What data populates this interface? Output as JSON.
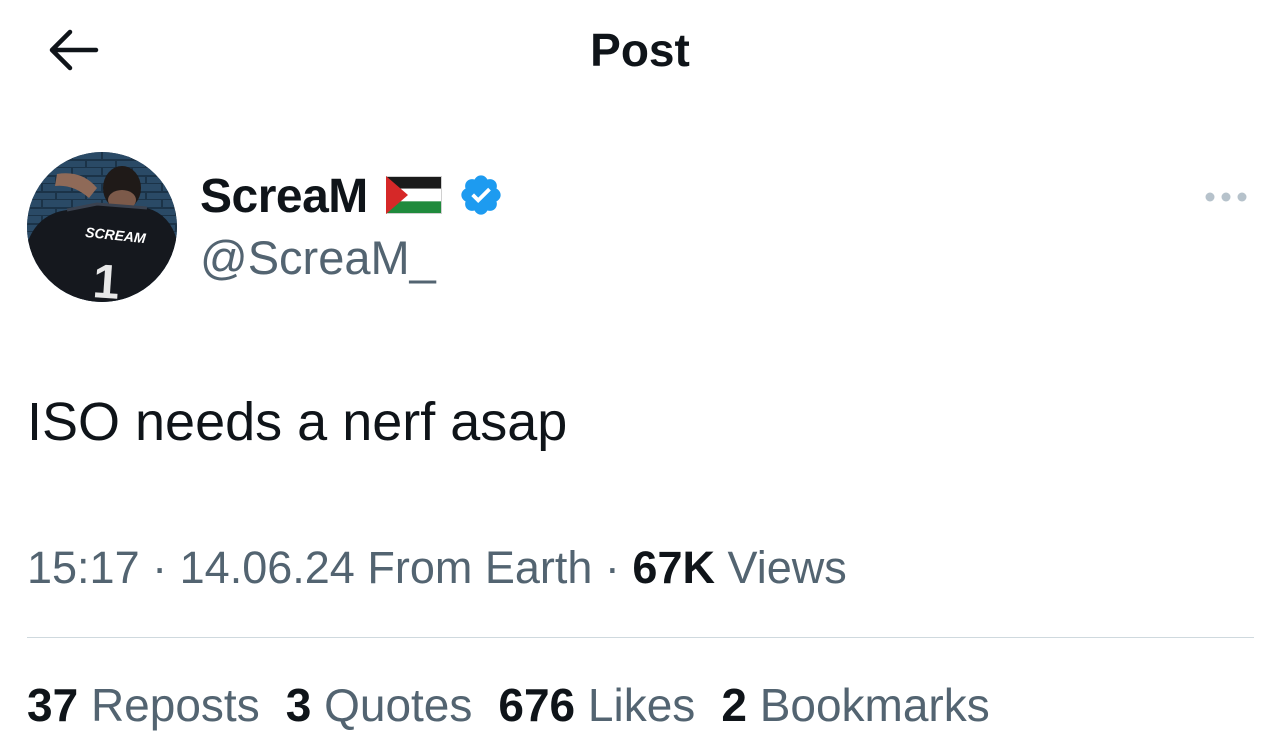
{
  "header": {
    "title": "Post",
    "back_icon": "arrow-left-icon"
  },
  "author": {
    "display_name": "ScreaM",
    "flag_icon": "palestine-flag-icon",
    "verified_icon": "verified-badge-icon",
    "verified_color": "#1d9bf0",
    "handle": "@ScreaM_",
    "avatar_jersey_text": "SCREAM",
    "avatar_jersey_number": "1",
    "more_icon": "more-horizontal-icon"
  },
  "tweet": {
    "text": "ISO needs a nerf asap"
  },
  "meta": {
    "time": "15:17",
    "separator": "·",
    "date": "14.06.24",
    "location": "From Earth",
    "views_count": "67K",
    "views_label": "Views"
  },
  "stats": [
    {
      "count": "37",
      "label": "Reposts"
    },
    {
      "count": "3",
      "label": "Quotes"
    },
    {
      "count": "676",
      "label": "Likes"
    },
    {
      "count": "2",
      "label": "Bookmarks"
    }
  ],
  "colors": {
    "text_primary": "#0f1419",
    "text_secondary": "#536471",
    "divider": "#cfd9de"
  }
}
